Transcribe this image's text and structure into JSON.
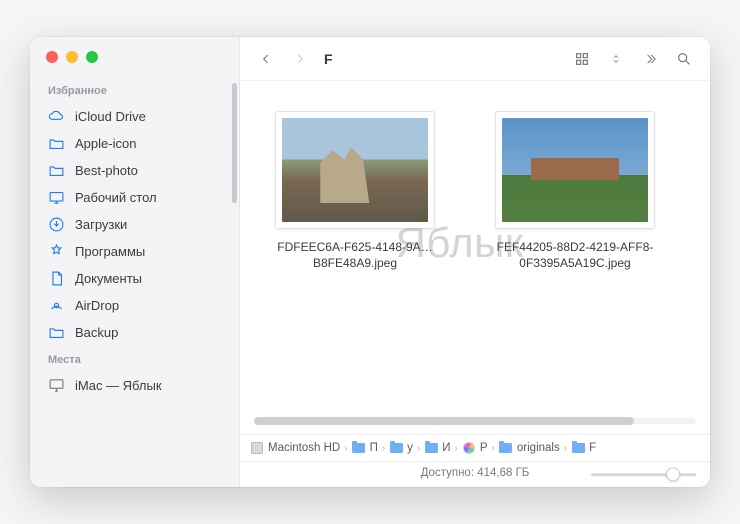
{
  "window": {
    "title": "F"
  },
  "sidebar": {
    "sections": [
      {
        "title": "Избранное",
        "items": [
          {
            "icon": "cloud",
            "label": "iCloud Drive"
          },
          {
            "icon": "folder",
            "label": "Apple-icon"
          },
          {
            "icon": "folder",
            "label": "Best-photo"
          },
          {
            "icon": "desktop",
            "label": "Рабочий стол"
          },
          {
            "icon": "download",
            "label": "Загрузки"
          },
          {
            "icon": "apps",
            "label": "Программы"
          },
          {
            "icon": "doc",
            "label": "Документы"
          },
          {
            "icon": "airdrop",
            "label": "AirDrop"
          },
          {
            "icon": "folder",
            "label": "Backup"
          }
        ]
      },
      {
        "title": "Места",
        "items": [
          {
            "icon": "imac",
            "label": "iMac — Яблык"
          }
        ]
      }
    ]
  },
  "files": [
    {
      "name": "FDFEEC6A-F625-4148-9A…B8FE48A9.jpeg"
    },
    {
      "name": "FEF44205-88D2-4219-AFF8-0F3395A5A19C.jpeg"
    }
  ],
  "path": [
    {
      "icon": "disk",
      "label": "Macintosh HD"
    },
    {
      "icon": "folder",
      "label": "П"
    },
    {
      "icon": "folder",
      "label": "y"
    },
    {
      "icon": "folder",
      "label": "И"
    },
    {
      "icon": "lib",
      "label": "P"
    },
    {
      "icon": "folder",
      "label": "originals"
    },
    {
      "icon": "folder",
      "label": "F"
    }
  ],
  "status": {
    "text": "Доступно: 414,68 ГБ"
  },
  "watermark": "Яблык"
}
